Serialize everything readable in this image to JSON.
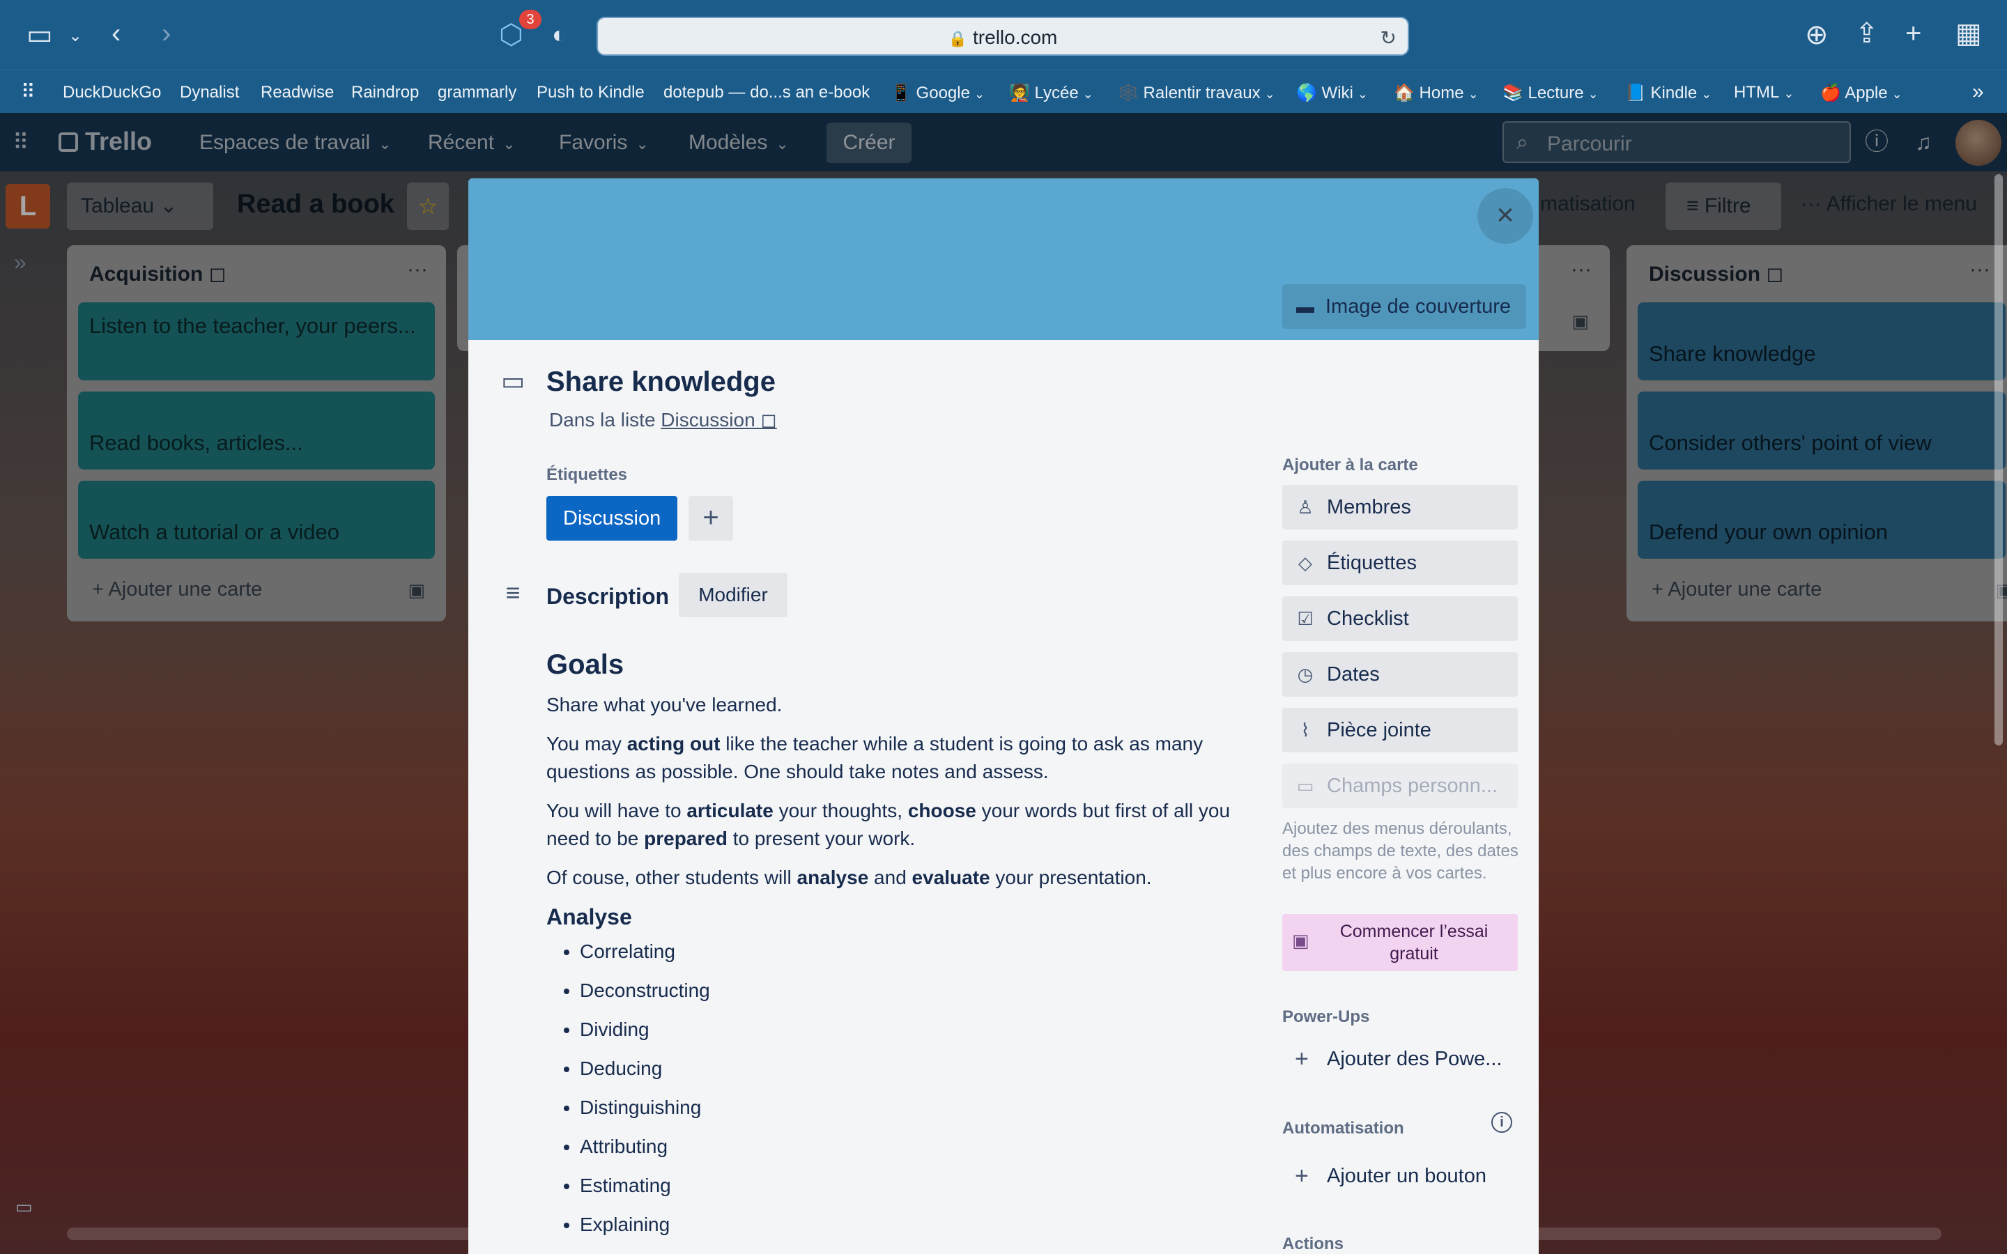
{
  "browser": {
    "tab_count": "3",
    "address": "trello.com",
    "bookmarks": [
      {
        "label": "DuckDuckGo"
      },
      {
        "label": "Dynalist"
      },
      {
        "label": "Readwise"
      },
      {
        "label": "Raindrop"
      },
      {
        "label": "grammarly"
      },
      {
        "label": "Push to Kindle"
      },
      {
        "label": "dotepub — do...s an e-book"
      },
      {
        "label": "📱 Google"
      },
      {
        "label": "🧑‍🏫 Lycée"
      },
      {
        "label": "🕸️ Ralentir travaux"
      },
      {
        "label": "🌎 Wiki"
      },
      {
        "label": "🏠 Home"
      },
      {
        "label": "📚 Lecture"
      },
      {
        "label": "📘 Kindle"
      },
      {
        "label": "HTML"
      },
      {
        "label": "🍎 Apple"
      }
    ]
  },
  "trello_header": {
    "logo": "Trello",
    "nav": [
      "Espaces de travail",
      "Récent",
      "Favoris",
      "Modèles"
    ],
    "create": "Créer",
    "search_placeholder": "Parcourir"
  },
  "board": {
    "initial": "L",
    "view": "Tableau",
    "title": "Read a book",
    "automation_partial": "matisation",
    "filter": "Filtre",
    "show_menu": "Afficher le menu",
    "lists": [
      {
        "title": "Acquisition ◻",
        "cards": [
          "Listen to the teacher, your peers...",
          "Read books, articles...",
          "Watch a tutorial or a video"
        ],
        "add": "Ajouter une carte"
      },
      {
        "title": "Discussion ◻",
        "cards": [
          "Share knowledge",
          "Consider others' point of view",
          "Defend your own opinion"
        ],
        "add": "Ajouter une carte"
      }
    ]
  },
  "card": {
    "cover_button": "Image de couverture",
    "title": "Share knowledge",
    "in_list_prefix": "Dans la liste",
    "in_list_name": "Discussion ◻",
    "labels_heading": "Étiquettes",
    "label": "Discussion",
    "description_heading": "Description",
    "edit": "Modifier",
    "description": {
      "h1": "Goals",
      "p1": "Share what you've learned.",
      "p2_pre": "You may ",
      "p2_b": "acting out",
      "p2_post": " like the teacher while a student is going to ask as many questions as possible. One should take notes and assess.",
      "p3_a": "You will have to ",
      "p3_b1": "articulate",
      "p3_c": " your thoughts, ",
      "p3_b2": "choose",
      "p3_d": " your words but first of all you need to be ",
      "p3_b3": "prepared",
      "p3_e": " to present your work.",
      "p4_a": "Of couse, other students will ",
      "p4_b1": "analyse",
      "p4_c": " and ",
      "p4_b2": "evaluate",
      "p4_d": " your presentation.",
      "h2": "Analyse",
      "items": [
        "Correlating",
        "Deconstructing",
        "Dividing",
        "Deducing",
        "Distinguishing",
        "Attributing",
        "Estimating",
        "Explaining"
      ]
    }
  },
  "side": {
    "add_heading": "Ajouter à la carte",
    "buttons": [
      "Membres",
      "Étiquettes",
      "Checklist",
      "Dates",
      "Pièce jointe",
      "Champs personn..."
    ],
    "custom_fields_note": "Ajoutez des menus déroulants, des champs de texte, des dates et plus encore à vos cartes.",
    "trial": "Commencer l’essai gratuit",
    "powerups_heading": "Power-Ups",
    "add_powerups": "Ajouter des Powe...",
    "automation_heading": "Automatisation",
    "add_button": "Ajouter un bouton",
    "actions_heading": "Actions"
  }
}
